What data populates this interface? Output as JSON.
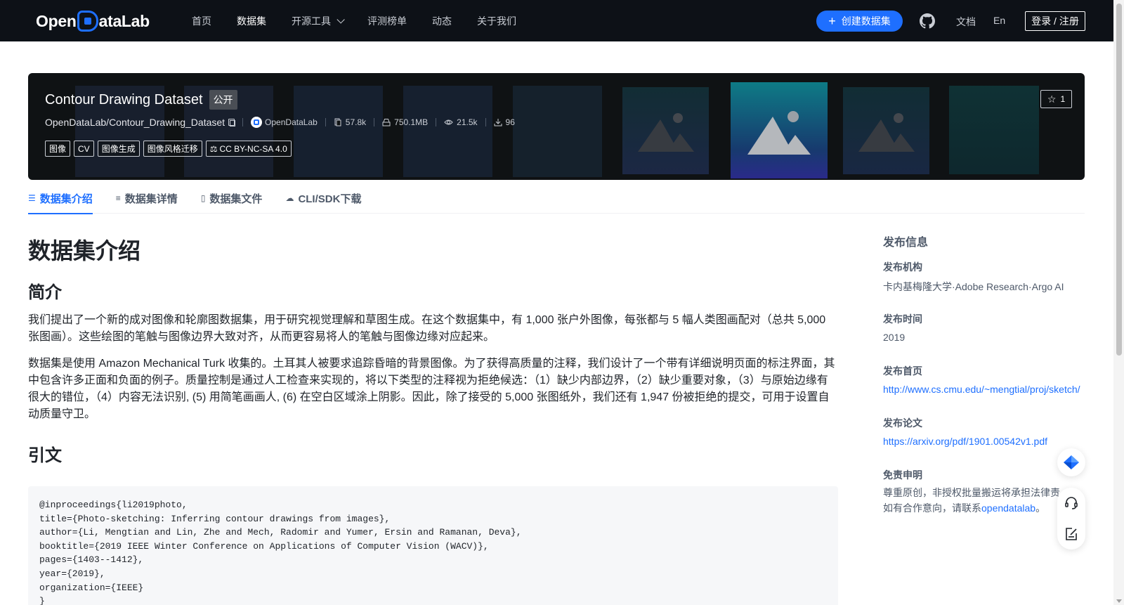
{
  "nav": {
    "brand_prefix": "Open",
    "brand_suffix": "ataLab",
    "items": [
      {
        "label": "首页"
      },
      {
        "label": "数据集"
      },
      {
        "label": "开源工具"
      },
      {
        "label": "评测榜单"
      },
      {
        "label": "动态"
      },
      {
        "label": "关于我们"
      }
    ],
    "create_label": "创建数据集",
    "docs_label": "文档",
    "lang_label": "En",
    "login_label": "登录 / 注册",
    "accent_color": "#1e6fff"
  },
  "dataset": {
    "title": "Contour Drawing Dataset",
    "visibility": "公开",
    "path": "OpenDataLab/Contour_Drawing_Dataset",
    "org": "OpenDataLab",
    "files": "57.8k",
    "size": "750.1MB",
    "views": "21.5k",
    "downloads": "96",
    "tags": [
      "图像",
      "CV",
      "图像生成",
      "图像风格迁移"
    ],
    "license": "CC BY-NC-SA 4.0",
    "stars": "1"
  },
  "tabs": [
    {
      "label": "数据集介绍",
      "icon": "database-icon"
    },
    {
      "label": "数据集详情",
      "icon": "list-icon"
    },
    {
      "label": "数据集文件",
      "icon": "file-icon"
    },
    {
      "label": "CLI/SDK下载",
      "icon": "cloud-download-icon"
    }
  ],
  "content": {
    "heading": "数据集介绍",
    "intro_heading": "简介",
    "para1": "我们提出了一个新的成对图像和轮廓图数据集，用于研究视觉理解和草图生成。在这个数据集中，有 1,000 张户外图像，每张都与 5 幅人类图画配对（总共 5,000 张图画）。这些绘图的笔触与图像边界大致对齐，从而更容易将人的笔触与图像边缘对应起来。",
    "para2": "数据集是使用 Amazon Mechanical Turk 收集的。土耳其人被要求追踪昏暗的背景图像。为了获得高质量的注释，我们设计了一个带有详细说明页面的标注界面，其中包含许多正面和负面的例子。质量控制是通过人工检查来实现的，将以下类型的注释视为拒绝候选：（1）缺少内部边界，（2）缺少重要对象，（3）与原始边缘有很大的错位，（4）内容无法识别, (5) 用简笔画画人, (6) 在空白区域涂上阴影。因此，除了接受的 5,000 张图纸外，我们还有 1,947 份被拒绝的提交，可用于设置自动质量守卫。",
    "citation_heading": "引文",
    "citation": "@inproceedings{li2019photo,\ntitle={Photo-sketching: Inferring contour drawings from images},\nauthor={Li, Mengtian and Lin, Zhe and Mech, Radomir and Yumer, Ersin and Ramanan, Deva},\nbooktitle={2019 IEEE Winter Conference on Applications of Computer Vision (WACV)},\npages={1403--1412},\nyear={2019},\norganization={IEEE}\n}"
  },
  "sidebar": {
    "title": "发布信息",
    "org_label": "发布机构",
    "org_value": "卡内基梅隆大学·Adobe Research·Argo AI",
    "time_label": "发布时间",
    "time_value": "2019",
    "home_label": "发布首页",
    "home_value": "http://www.cs.cmu.edu/~mengtial/proj/sketch/",
    "paper_label": "发布论文",
    "paper_value": "https://arxiv.org/pdf/1901.00542v1.pdf",
    "disclaimer_label": "免责申明",
    "disclaimer_line1": "尊重原创，非授权批量搬运将承担法律责",
    "disclaimer_line2_prefix": "如有合作意向，请联系",
    "disclaimer_link": "opendatalab",
    "disclaimer_line2_suffix": "。"
  }
}
